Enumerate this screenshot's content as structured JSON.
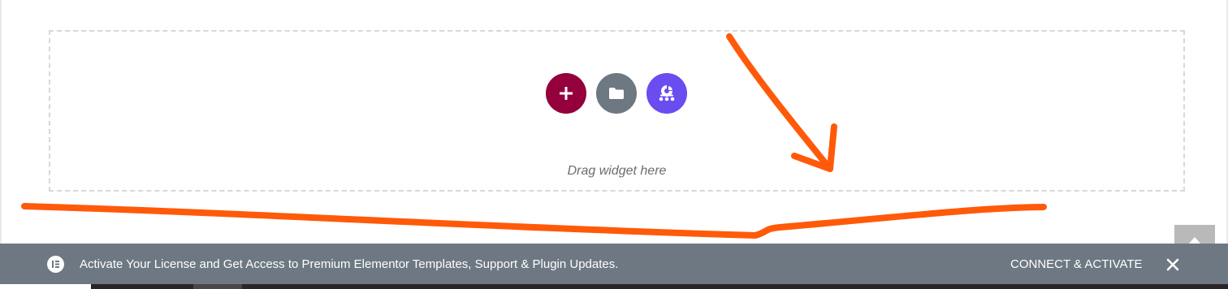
{
  "editor": {
    "drop_area": {
      "hint": "Drag widget here",
      "buttons": [
        {
          "id": "add",
          "icon": "plus-icon",
          "color": "#93003c"
        },
        {
          "id": "template-library",
          "icon": "folder-icon",
          "color": "#6d7882"
        },
        {
          "id": "ai",
          "icon": "ai-icon",
          "color": "#6a4cf0"
        }
      ]
    },
    "annotation_color": "#ff5a0a"
  },
  "notice": {
    "icon": "elementor-logo-icon",
    "message": "Activate Your License and Get Access to Premium Elementor Templates, Support & Plugin Updates.",
    "action_label": "CONNECT & ACTIVATE",
    "close_icon": "close-icon",
    "background": "#6d7882"
  },
  "scroll_top": {
    "icon": "caret-up-icon"
  }
}
